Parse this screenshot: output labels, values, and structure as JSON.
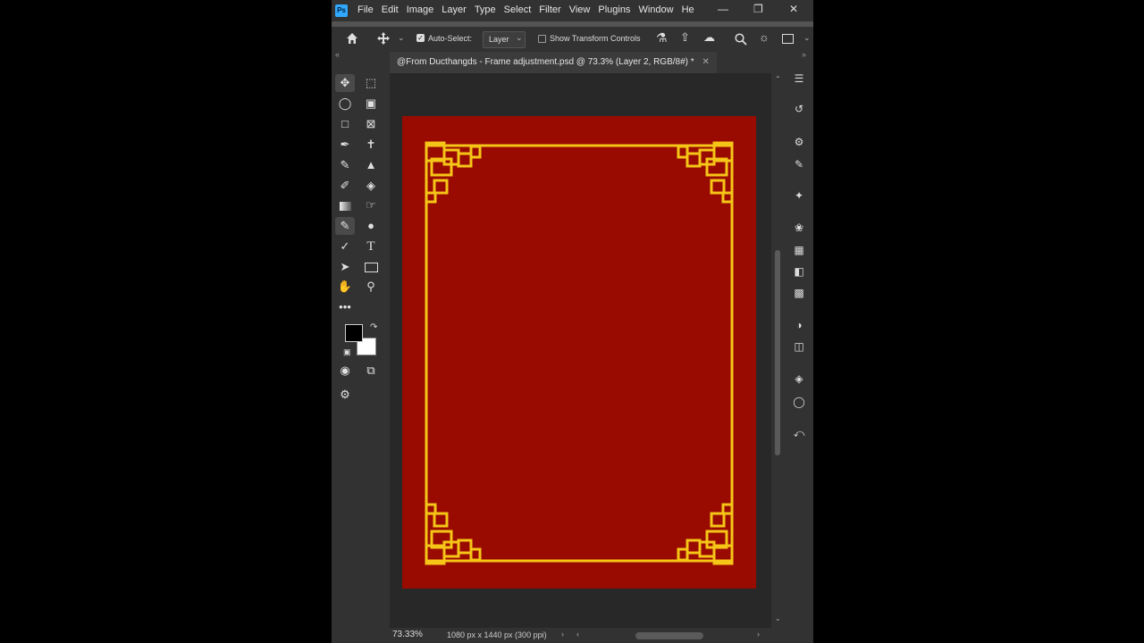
{
  "menubar": {
    "logo": "Ps",
    "menus": [
      "File",
      "Edit",
      "Image",
      "Layer",
      "Type",
      "Select",
      "Filter",
      "View",
      "Plugins",
      "Window",
      "He"
    ]
  },
  "options": {
    "auto_select_label": "Auto-Select:",
    "auto_select_checked": true,
    "layer_dropdown": "Layer",
    "transform_label": "Show Transform Controls",
    "transform_checked": false
  },
  "document": {
    "tab_title": "@From Ducthangds - Frame adjustment.psd @ 73.3% (Layer 2, RGB/8#) *",
    "canvas_color": "#990b00",
    "frame_color": "#f5c518"
  },
  "status": {
    "zoom": "73.33%",
    "doc_info": "1080 px x 1440 px (300 ppi)"
  },
  "colors": {
    "foreground": "#000000",
    "background": "#ffffff"
  },
  "tools": [
    "move-tool-icon",
    "artboard-marquee-icon",
    "lasso-icon",
    "object-select-icon",
    "crop-icon",
    "frame-icon",
    "eyedropper-icon",
    "spot-healing-icon",
    "brush-icon",
    "stamp-icon",
    "history-brush-icon",
    "eraser-icon",
    "gradient-icon",
    "smudge-icon",
    "paint-icon",
    "dodge-icon",
    "pen-icon",
    "type-icon",
    "path-select-icon",
    "rectangle-icon",
    "hand-icon",
    "zoom-icon"
  ]
}
